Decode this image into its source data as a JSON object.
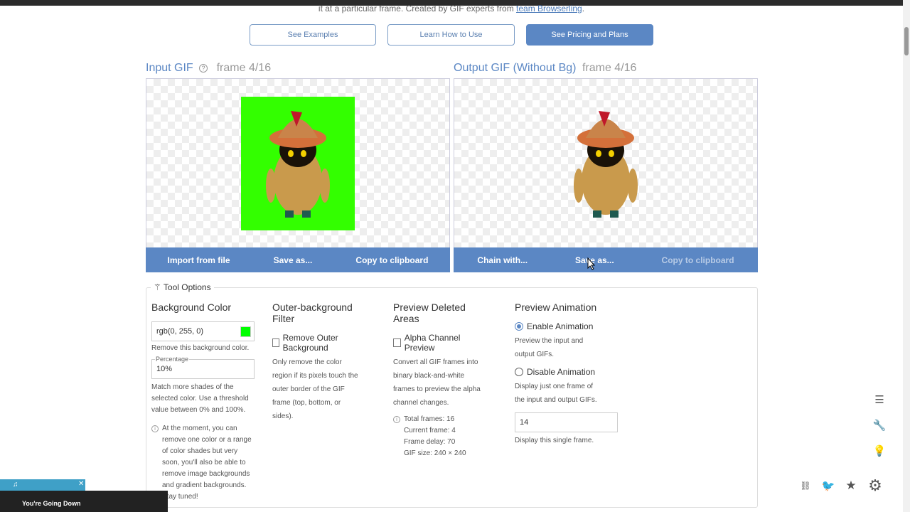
{
  "intro": {
    "text": "it at a particular frame. Created by GIF experts from ",
    "link": "team Browserling",
    "tail": "."
  },
  "nav_buttons": {
    "examples": "See Examples",
    "learn": "Learn How to Use",
    "pricing": "See Pricing and Plans"
  },
  "input_panel": {
    "title": "Input GIF",
    "frame": "frame 4/16",
    "actions": [
      "Import from file",
      "Save as...",
      "Copy to clipboard"
    ]
  },
  "output_panel": {
    "title": "Output GIF (Without Bg)",
    "frame": "frame 4/16",
    "actions": [
      "Chain with...",
      "Save as...",
      "Copy to clipboard"
    ]
  },
  "tool_options": {
    "legend": "Tool Options",
    "background_color": {
      "heading": "Background Color",
      "value": "rgb(0, 255, 0)",
      "swatch": "#00ff00",
      "desc": "Remove this background color.",
      "percentage_label": "Percentage",
      "percentage_value": "10%",
      "match_desc": "Match more shades of the selected color. Use a threshold value between 0% and 100%.",
      "note": "At the moment, you can remove one color or a range of color shades but very soon, you'll also be able to remove image backgrounds and gradient backgrounds. Stay tuned!"
    },
    "outer_filter": {
      "heading": "Outer-background Filter",
      "checkbox_label": "Remove Outer Background",
      "desc": "Only remove the color region if its pixels touch the outer border of the GIF frame (top, bottom, or sides)."
    },
    "preview_deleted": {
      "heading": "Preview Deleted Areas",
      "checkbox_label": "Alpha Channel Preview",
      "desc": "Convert all GIF frames into binary black-and-white frames to preview the alpha channel changes.",
      "stats": [
        "Total frames: 16",
        "Current frame: 4",
        "Frame delay: 70",
        "GIF size: 240 × 240"
      ]
    },
    "preview_animation": {
      "heading": "Preview Animation",
      "enable_label": "Enable Animation",
      "enable_desc": "Preview the input and output GIFs.",
      "disable_label": "Disable Animation",
      "disable_desc": "Display just one frame of the input and output GIFs.",
      "frame_value": "14",
      "frame_desc": "Display this single frame."
    }
  },
  "media": {
    "title": "You're Going Down"
  },
  "colors": {
    "accent": "#5b87c4",
    "green_bg": "#33ff00"
  }
}
